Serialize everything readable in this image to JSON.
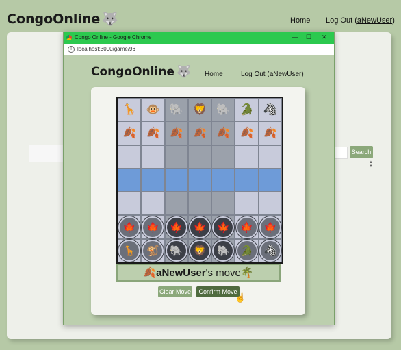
{
  "app": {
    "logo_text": "CongoOnline",
    "logo_icon": "wolf-head-icon"
  },
  "bg_nav": {
    "home": "Home",
    "logout_prefix": "Log Out (",
    "logout_user": "aNewUser",
    "logout_suffix": ")"
  },
  "bg_page": {
    "search_button": "Search",
    "exclaim": "!"
  },
  "window": {
    "title": "Congo Online - Google Chrome",
    "url": "localhost:3000/game/96",
    "min": "—",
    "max": "☐",
    "close": "✕"
  },
  "win_nav": {
    "home": "Home",
    "logout_prefix": "Log Out (",
    "logout_user": "aNewUser",
    "logout_suffix": ")"
  },
  "board": {
    "rows": [
      [
        "🦒",
        "🐵",
        "🐘",
        "🦁",
        "🐘",
        "🐊",
        "🦓"
      ],
      [
        "🍂",
        "🍂",
        "🍂",
        "🍂",
        "🍂",
        "🍂",
        "🍂"
      ],
      [
        "",
        "",
        "",
        "",
        "",
        "",
        ""
      ],
      [
        "",
        "",
        "",
        "",
        "",
        "",
        ""
      ],
      [
        "",
        "",
        "",
        "",
        "",
        "",
        ""
      ],
      [
        "🍁",
        "🍁",
        "🍁",
        "🍁",
        "🍁",
        "🍁",
        "🍁"
      ],
      [
        "🦒",
        "🐒",
        "🐘",
        "🦁",
        "🐘",
        "🐊",
        "🦓"
      ]
    ]
  },
  "status": {
    "player": "aNewUser",
    "suffix": "'s move",
    "left_icon": "🍂",
    "right_icon": "🌴"
  },
  "buttons": {
    "clear": "Clear Move",
    "confirm": "Confirm Move"
  }
}
